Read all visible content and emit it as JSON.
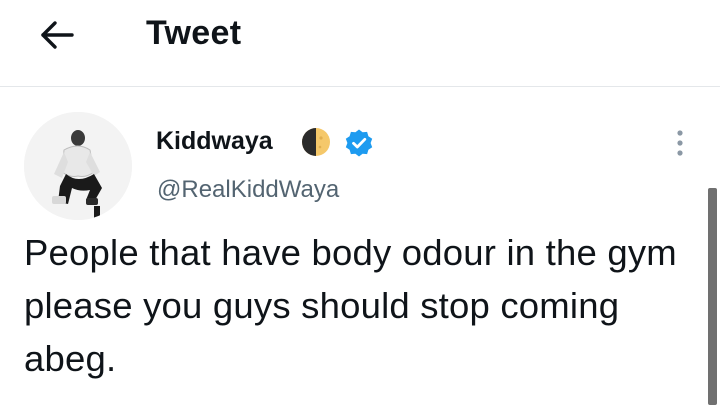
{
  "header": {
    "title": "Tweet",
    "back_icon": "arrow-left-icon"
  },
  "tweet": {
    "author": {
      "name": "Kiddwaya",
      "handle": "@RealKiddWaya",
      "name_emoji": "moon-icon",
      "verified": true,
      "verified_color": "#1d9bf0"
    },
    "text": "People that have body odour in the gym please you guys should stop coming abeg.",
    "more_icon": "more-vertical-icon"
  },
  "colors": {
    "text": "#0f1419",
    "secondary_text": "#536471",
    "divider": "#e4e7ea"
  }
}
